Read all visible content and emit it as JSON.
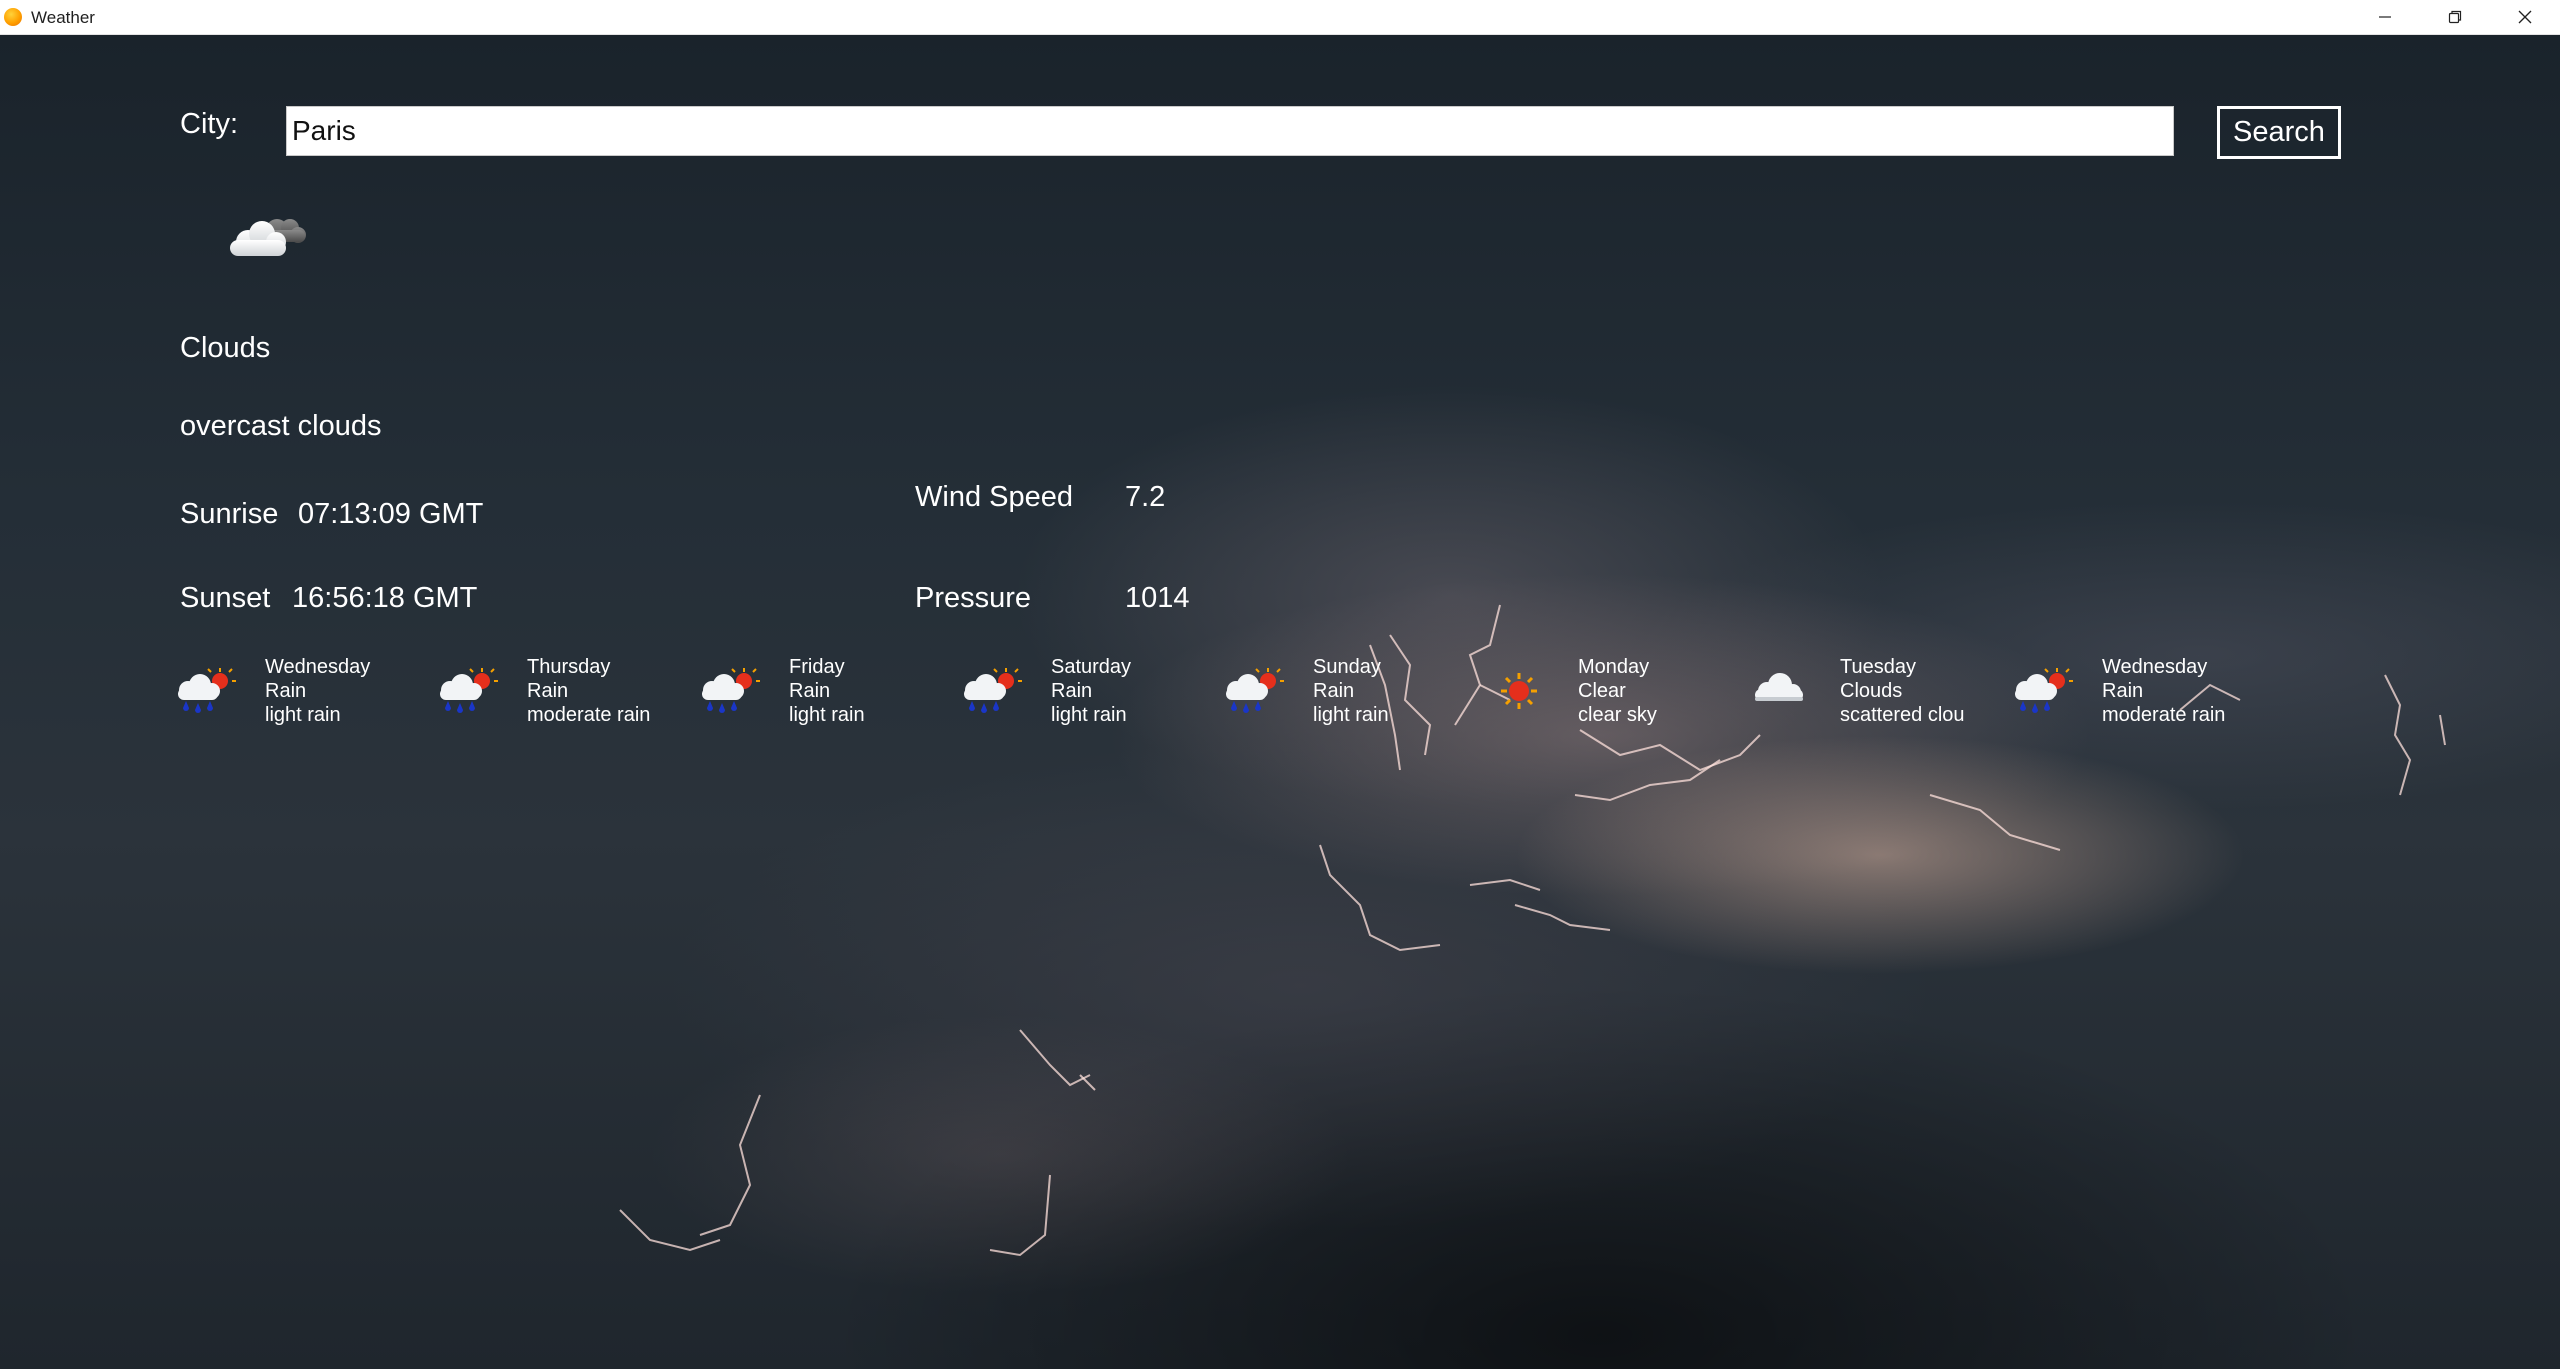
{
  "window": {
    "title": "Weather",
    "controls": [
      "minimize",
      "restore",
      "close"
    ]
  },
  "search": {
    "label": "City:",
    "value": "Paris",
    "button": "Search"
  },
  "current": {
    "icon": "cloud-icon",
    "condition": "Clouds",
    "description": "overcast clouds",
    "sunrise_label": "Sunrise",
    "sunrise": "07:13:09 GMT",
    "sunset_label": "Sunset",
    "sunset": "16:56:18 GMT",
    "wind_label": "Wind Speed",
    "wind": "7.2",
    "pressure_label": "Pressure",
    "pressure": "1014"
  },
  "forecast": [
    {
      "day": "Wednesday",
      "main": "Rain",
      "desc": "light rain",
      "icon": "rain-sun-icon"
    },
    {
      "day": "Thursday",
      "main": "Rain",
      "desc": "moderate rain",
      "icon": "rain-sun-icon"
    },
    {
      "day": "Friday",
      "main": "Rain",
      "desc": "light rain",
      "icon": "rain-sun-icon"
    },
    {
      "day": "Saturday",
      "main": "Rain",
      "desc": "light rain",
      "icon": "rain-sun-icon"
    },
    {
      "day": "Sunday",
      "main": "Rain",
      "desc": "light rain",
      "icon": "rain-sun-icon"
    },
    {
      "day": "Monday",
      "main": "Clear",
      "desc": "clear sky",
      "icon": "sun-icon"
    },
    {
      "day": "Tuesday",
      "main": "Clouds",
      "desc": "scattered clou",
      "icon": "cloud-icon"
    },
    {
      "day": "Wednesday",
      "main": "Rain",
      "desc": "moderate rain",
      "icon": "rain-sun-icon"
    }
  ]
}
